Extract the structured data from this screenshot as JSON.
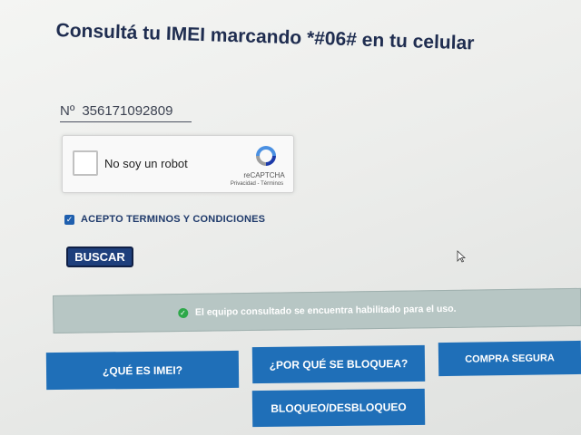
{
  "header": {
    "title": "Consultá tu IMEI marcando *#06# en tu celular"
  },
  "imei": {
    "prefix": "Nº",
    "value": "356171092809"
  },
  "recaptcha": {
    "label": "No soy un robot",
    "brand": "reCAPTCHA",
    "links": "Privacidad - Términos",
    "checked": false
  },
  "terms": {
    "label": "ACEPTO TERMINOS Y CONDICIONES",
    "checked": true
  },
  "search": {
    "label": "BUSCAR"
  },
  "status": {
    "message": "El equipo consultado se encuentra habilitado para el uso.",
    "icon": "check-circle-icon",
    "color": "#2ea84a"
  },
  "nav": {
    "what_is_imei": "¿QUÉ ES IMEI?",
    "why_blocked": "¿POR QUÉ SE BLOQUEA?",
    "safe_purchase": "COMPRA SEGURA",
    "block_unblock": "BLOQUEO/DESBLOQUEO"
  },
  "colors": {
    "title": "#1f2d50",
    "button_primary": "#1e3f7c",
    "nav_button": "#1f6fb8",
    "banner": "#b7c6c4"
  }
}
